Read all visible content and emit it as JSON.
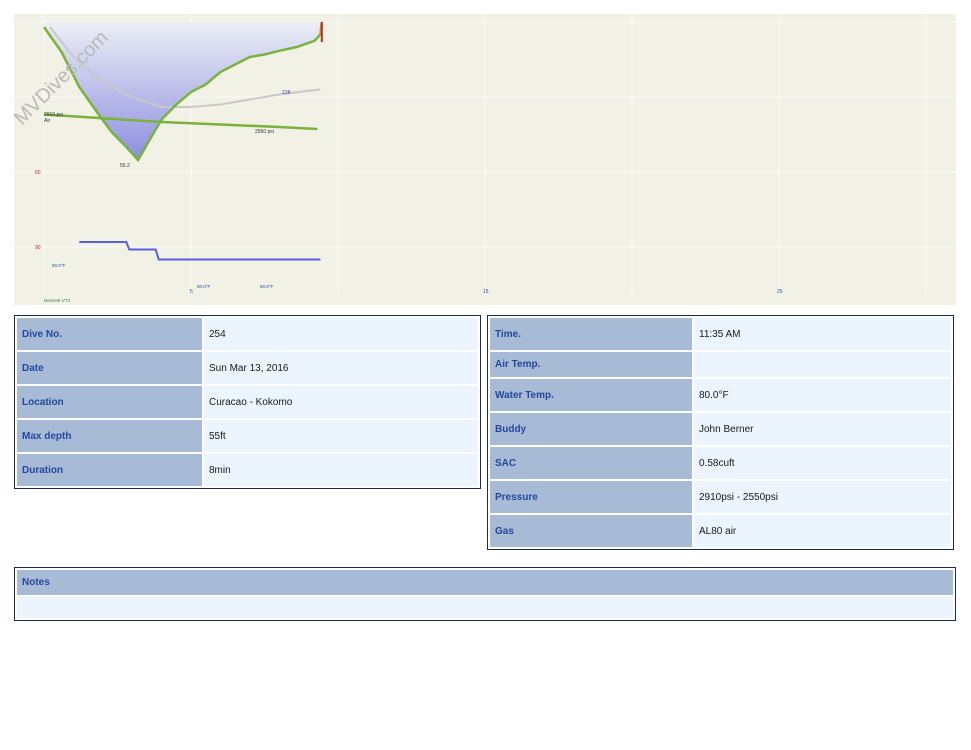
{
  "profile": {
    "watermark": "MVDives.com",
    "colors": {
      "background": "#f1f1e6",
      "grid": "#ffffff",
      "depth_fill_top": "#eceef5",
      "depth_fill_bottom": "#8d8ee0",
      "temp_line": "#c8c8c8",
      "pressure_line": "#7ab23c",
      "gas_line": "#5a5fe0",
      "ceiling": "#e01b1b",
      "axis_text": "#3344aa"
    },
    "depth_axis_labels": [
      "60",
      "90"
    ],
    "time_axis_labels": [
      "5",
      "15",
      "25"
    ],
    "max_depth_label": "55.2",
    "pressure_start_label": "2910 psi",
    "pressure_start_gas": "Air",
    "pressure_end_label": "2550 psi",
    "temp_end_label": "21ft",
    "gas_start_label": "80.0°F",
    "gas_mid_label": "80.0°F",
    "gas_end_label": "80.0°F",
    "footer_label": "Descent VT4",
    "max_time_min": 30,
    "max_depth_ft": 105,
    "depth_points": [
      [
        0,
        2
      ],
      [
        0.6,
        12
      ],
      [
        1.2,
        26
      ],
      [
        1.8,
        36
      ],
      [
        2.3,
        44
      ],
      [
        2.8,
        50
      ],
      [
        3.2,
        55.2
      ],
      [
        3.6,
        47
      ],
      [
        4.0,
        39
      ],
      [
        4.5,
        33
      ],
      [
        5.0,
        28
      ],
      [
        5.5,
        25
      ],
      [
        6.0,
        20
      ],
      [
        6.5,
        17
      ],
      [
        7.0,
        14
      ],
      [
        7.5,
        13
      ],
      [
        8.0,
        11.5
      ],
      [
        8.6,
        10
      ],
      [
        9.2,
        7.5
      ],
      [
        9.4,
        5
      ],
      [
        9.45,
        0
      ]
    ],
    "temp_points": [
      [
        0.2,
        2
      ],
      [
        1,
        14
      ],
      [
        2,
        24
      ],
      [
        3,
        30
      ],
      [
        4,
        34
      ],
      [
        5,
        34
      ],
      [
        6,
        33
      ],
      [
        7,
        31
      ],
      [
        8,
        29
      ],
      [
        9,
        27.5
      ],
      [
        9.4,
        27
      ]
    ],
    "pressure_points": [
      [
        0,
        37
      ],
      [
        2,
        38.5
      ],
      [
        4,
        40
      ],
      [
        6,
        41
      ],
      [
        8,
        42
      ],
      [
        9.3,
        42.8
      ]
    ],
    "gas_points": [
      [
        1.2,
        88
      ],
      [
        2.8,
        88
      ],
      [
        2.9,
        91
      ],
      [
        3.8,
        91
      ],
      [
        3.9,
        95
      ],
      [
        9.4,
        95
      ]
    ]
  },
  "left_table": {
    "rows": [
      {
        "label": "Dive No.",
        "value": "254"
      },
      {
        "label": "Date",
        "value": "Sun Mar 13, 2016"
      },
      {
        "label": "Location",
        "value": "Curacao - Kokomo"
      },
      {
        "label": "Max depth",
        "value": "55ft"
      },
      {
        "label": "Duration",
        "value": "8min"
      }
    ]
  },
  "right_table": {
    "rows": [
      {
        "label": "Time.",
        "value": "11:35 AM"
      },
      {
        "label": "Air Temp.",
        "value": ""
      },
      {
        "label": "Water Temp.",
        "value": "80.0°F"
      },
      {
        "label": "Buddy",
        "value": "John Berner"
      },
      {
        "label": "SAC",
        "value": "0.58cuft"
      },
      {
        "label": "Pressure",
        "value": "2910psi - 2550psi"
      },
      {
        "label": "Gas",
        "value": "AL80 air"
      }
    ]
  },
  "notes": {
    "label": "Notes",
    "value": ""
  }
}
